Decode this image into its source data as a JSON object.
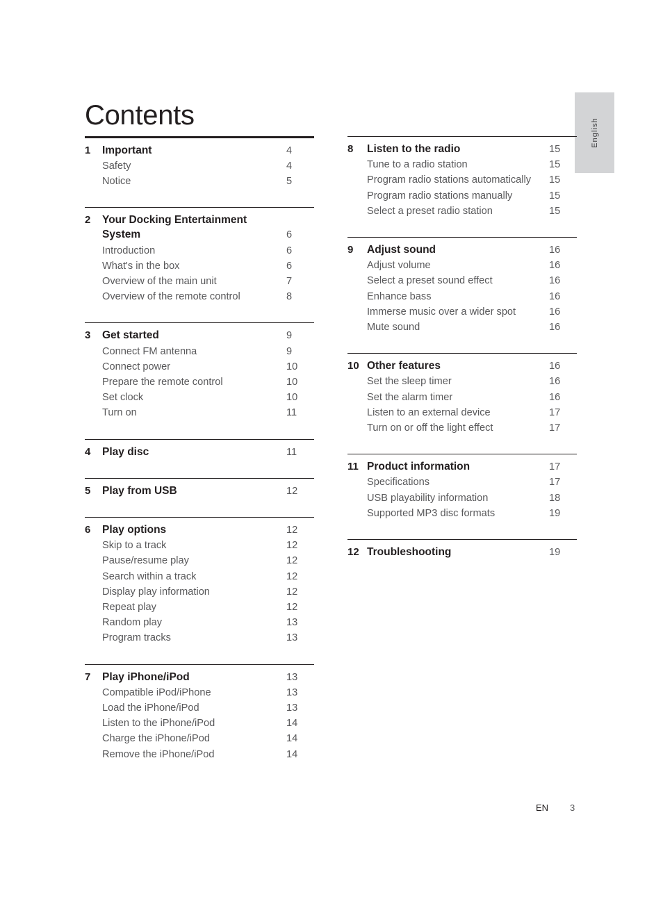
{
  "page_title": "Contents",
  "language_tab": "English",
  "footer": {
    "locale": "EN",
    "page_number": "3"
  },
  "columns": {
    "left": [
      {
        "number": "1",
        "title": "Important",
        "page": "4",
        "rule": "thick",
        "items": [
          {
            "label": "Safety",
            "page": "4"
          },
          {
            "label": "Notice",
            "page": "5"
          }
        ]
      },
      {
        "number": "2",
        "title_line1": "Your Docking Entertainment",
        "title_line2": "System",
        "page": "6",
        "rule": "thin",
        "items": [
          {
            "label": "Introduction",
            "page": "6"
          },
          {
            "label": "What's in the box",
            "page": "6"
          },
          {
            "label": "Overview of the main unit",
            "page": "7"
          },
          {
            "label": "Overview of the remote control",
            "page": "8"
          }
        ]
      },
      {
        "number": "3",
        "title": "Get started",
        "page": "9",
        "rule": "thin",
        "items": [
          {
            "label": "Connect FM antenna",
            "page": "9"
          },
          {
            "label": "Connect power",
            "page": "10"
          },
          {
            "label": "Prepare the remote control",
            "page": "10"
          },
          {
            "label": "Set clock",
            "page": "10"
          },
          {
            "label": "Turn on",
            "page": "11"
          }
        ]
      },
      {
        "number": "4",
        "title": "Play disc",
        "page": "11",
        "rule": "thin",
        "items": []
      },
      {
        "number": "5",
        "title": "Play from USB",
        "page": "12",
        "rule": "thin",
        "items": []
      },
      {
        "number": "6",
        "title": "Play options",
        "page": "12",
        "rule": "thin",
        "items": [
          {
            "label": "Skip to a track",
            "page": "12"
          },
          {
            "label": "Pause/resume play",
            "page": "12"
          },
          {
            "label": "Search within a track",
            "page": "12"
          },
          {
            "label": "Display play information",
            "page": "12"
          },
          {
            "label": "Repeat play",
            "page": "12"
          },
          {
            "label": "Random play",
            "page": "13"
          },
          {
            "label": "Program tracks",
            "page": "13"
          }
        ]
      },
      {
        "number": "7",
        "title": "Play iPhone/iPod",
        "page": "13",
        "rule": "thin",
        "items": [
          {
            "label": "Compatible iPod/iPhone",
            "page": "13"
          },
          {
            "label": "Load the iPhone/iPod",
            "page": "13"
          },
          {
            "label": "Listen to the iPhone/iPod",
            "page": "14"
          },
          {
            "label": "Charge the iPhone/iPod",
            "page": "14"
          },
          {
            "label": "Remove the iPhone/iPod",
            "page": "14"
          }
        ]
      }
    ],
    "right": [
      {
        "number": "8",
        "title": "Listen to the radio",
        "page": "15",
        "rule": "thin",
        "items": [
          {
            "label": "Tune to a radio station",
            "page": "15"
          },
          {
            "label": "Program radio stations automatically",
            "page": "15"
          },
          {
            "label": "Program radio stations manually",
            "page": "15"
          },
          {
            "label": "Select a preset radio station",
            "page": "15"
          }
        ]
      },
      {
        "number": "9",
        "title": "Adjust sound",
        "page": "16",
        "rule": "thin",
        "items": [
          {
            "label": "Adjust volume",
            "page": "16"
          },
          {
            "label": "Select a preset sound effect",
            "page": "16"
          },
          {
            "label": "Enhance bass",
            "page": "16"
          },
          {
            "label": "Immerse music over a wider spot",
            "page": "16"
          },
          {
            "label": "Mute sound",
            "page": "16"
          }
        ]
      },
      {
        "number": "10",
        "title": "Other features",
        "page": "16",
        "rule": "thin",
        "items": [
          {
            "label": "Set the sleep timer",
            "page": "16"
          },
          {
            "label": "Set the alarm timer",
            "page": "16"
          },
          {
            "label": "Listen to an external device",
            "page": "17"
          },
          {
            "label": "Turn on or off the light effect",
            "page": "17"
          }
        ]
      },
      {
        "number": "11",
        "title": "Product information",
        "page": "17",
        "rule": "thin",
        "items": [
          {
            "label": "Specifications",
            "page": "17"
          },
          {
            "label": "USB playability information",
            "page": "18"
          },
          {
            "label": "Supported MP3 disc formats",
            "page": "19"
          }
        ]
      },
      {
        "number": "12",
        "title": "Troubleshooting",
        "page": "19",
        "rule": "thin",
        "items": []
      }
    ]
  }
}
